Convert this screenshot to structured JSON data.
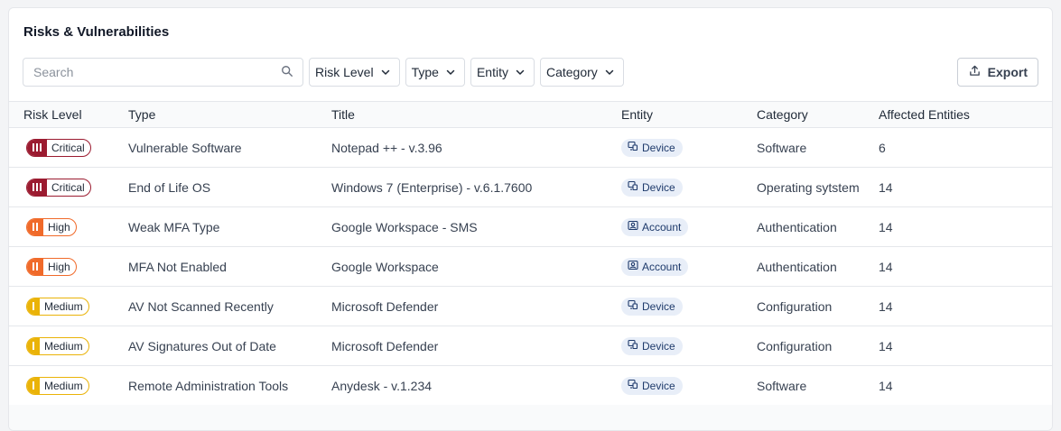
{
  "header": {
    "title": "Risks & Vulnerabilities"
  },
  "toolbar": {
    "search_placeholder": "Search",
    "filters": [
      "Risk Level",
      "Type",
      "Entity",
      "Category"
    ],
    "export_label": "Export"
  },
  "table": {
    "columns": [
      "Risk Level",
      "Type",
      "Title",
      "Entity",
      "Category",
      "Affected Entities"
    ],
    "rows": [
      {
        "risk": "Critical",
        "type": "Vulnerable Software",
        "title": "Notepad ++ - v.3.96",
        "entity": "Device",
        "category": "Software",
        "affected": "6"
      },
      {
        "risk": "Critical",
        "type": "End of Life OS",
        "title": "Windows 7 (Enterprise) - v.6.1.7600",
        "entity": "Device",
        "category": "Operating sytstem",
        "affected": "14"
      },
      {
        "risk": "High",
        "type": "Weak MFA Type",
        "title": "Google Workspace - SMS",
        "entity": "Account",
        "category": "Authentication",
        "affected": "14"
      },
      {
        "risk": "High",
        "type": "MFA Not Enabled",
        "title": "Google Workspace",
        "entity": "Account",
        "category": "Authentication",
        "affected": "14"
      },
      {
        "risk": "Medium",
        "type": "AV Not Scanned Recently",
        "title": "Microsoft Defender",
        "entity": "Device",
        "category": "Configuration",
        "affected": "14"
      },
      {
        "risk": "Medium",
        "type": "AV Signatures Out of Date",
        "title": "Microsoft Defender",
        "entity": "Device",
        "category": "Configuration",
        "affected": "14"
      },
      {
        "risk": "Medium",
        "type": "Remote Administration Tools",
        "title": "Anydesk - v.1.234",
        "entity": "Device",
        "category": "Software",
        "affected": "14"
      }
    ]
  },
  "risk_colors": {
    "Critical": "#9b1b30",
    "High": "#f06a2a",
    "Medium": "#eab308"
  },
  "icons": {
    "search": "search-icon",
    "dropdown": "chevron-down-icon",
    "export": "upload-icon",
    "device": "device-icon",
    "account": "account-icon"
  }
}
